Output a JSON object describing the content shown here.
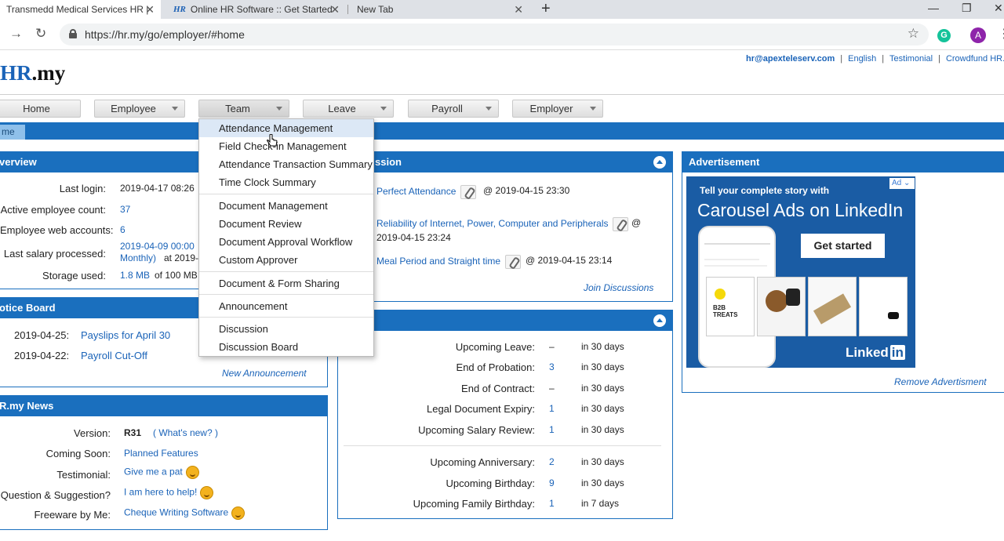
{
  "browser": {
    "tabs": [
      {
        "title": "Transmedd Medical Services HR |"
      },
      {
        "title": "Online HR Software :: Get Started",
        "favicon": "HR"
      },
      {
        "title": "New Tab"
      }
    ],
    "url": "https://hr.my/go/employer/#home",
    "avatar": "A",
    "grammarly": "G"
  },
  "header": {
    "logo_hr": "HR",
    "logo_rest": ".my",
    "links": [
      {
        "label": "hr@apexteleserv.com"
      },
      {
        "label": "English"
      },
      {
        "label": "Testimonial"
      },
      {
        "label": "Crowdfund HR.m"
      }
    ]
  },
  "menu": [
    {
      "label": "Home"
    },
    {
      "label": "Employee"
    },
    {
      "label": "Team"
    },
    {
      "label": "Leave"
    },
    {
      "label": "Payroll"
    },
    {
      "label": "Employer"
    }
  ],
  "home_tab": "me",
  "overview": {
    "title": "verview",
    "rows": [
      {
        "label": "Last login:",
        "value": "2019-04-17 08:26"
      },
      {
        "label": "Active employee count:",
        "value": "37"
      },
      {
        "label": "Employee web accounts:",
        "value": "6"
      },
      {
        "label": "Last salary processed:",
        "value": "2019-04-09 00:00",
        "value2": "Monthly)",
        "value3": "at 2019-"
      },
      {
        "label": "Storage used:",
        "value": "1.8 MB",
        "value2": "of 100 MB"
      }
    ]
  },
  "notice_board": {
    "title": "otice Board",
    "items": [
      {
        "date": "2019-04-25:",
        "text": "Payslips for April 30"
      },
      {
        "date": "2019-04-22:",
        "text": "Payroll Cut-Off"
      }
    ],
    "new_link": "New Announcement"
  },
  "news": {
    "title": "R.my News",
    "rows": [
      {
        "label": "Version:",
        "value": "R31",
        "link": "( What's new? )"
      },
      {
        "label": "Coming Soon:",
        "link": "Planned Features"
      },
      {
        "label": "Testimonial:",
        "link": "Give me a pat"
      },
      {
        "label": "Question & Suggestion?",
        "link": "I am here to help!"
      },
      {
        "label": "Freeware by Me:",
        "link": "Cheque Writing Software"
      }
    ]
  },
  "discussion": {
    "title": "ssion",
    "items": [
      {
        "title": "Perfect Attendance",
        "time": "@ 2019-04-15 23:30"
      },
      {
        "title": "Reliability of Internet, Power, Computer and Peripherals",
        "at": "@",
        "time": "2019-04-15 23:24"
      },
      {
        "title": "Meal Period and Straight time",
        "time": "@ 2019-04-15 23:14"
      }
    ],
    "join_link": "Join Discussions"
  },
  "upcoming": {
    "rows": [
      {
        "label": "Upcoming Leave:",
        "value": "–",
        "period": "in 30 days"
      },
      {
        "label": "End of Probation:",
        "value": "3",
        "period": "in 30 days"
      },
      {
        "label": "End of Contract:",
        "value": "–",
        "period": "in 30 days"
      },
      {
        "label": "Legal Document Expiry:",
        "value": "1",
        "period": "in 30 days"
      },
      {
        "label": "Upcoming Salary Review:",
        "value": "1",
        "period": "in 30 days"
      },
      {
        "label": "Upcoming Anniversary:",
        "value": "2",
        "period": "in 30 days"
      },
      {
        "label": "Upcoming Birthday:",
        "value": "9",
        "period": "in 30 days"
      },
      {
        "label": "Upcoming Family Birthday:",
        "value": "1",
        "period": "in 7 days"
      }
    ]
  },
  "advertisement": {
    "title": "Advertisement",
    "badge": "Ad",
    "line1": "Tell your complete story with",
    "line2": "Carousel Ads on LinkedIn",
    "cta": "Get started",
    "brand": "Linked",
    "brand_in": "in",
    "card_text": "B2B TREATS",
    "remove_link": "Remove Advertisment"
  },
  "team_dropdown": {
    "items": [
      {
        "label": "Attendance Management"
      },
      {
        "label": "Field Check-in Management"
      },
      {
        "label": "Attendance Transaction Summary"
      },
      {
        "label": "Time Clock Summary"
      },
      {
        "label": "Document Management"
      },
      {
        "label": "Document Review"
      },
      {
        "label": "Document Approval Workflow"
      },
      {
        "label": "Custom Approver"
      },
      {
        "label": "Document & Form Sharing"
      },
      {
        "label": "Announcement"
      },
      {
        "label": "Discussion"
      },
      {
        "label": "Discussion Board"
      }
    ]
  },
  "colors": {
    "primary": "#1a6fbe",
    "link": "#1a63b8"
  }
}
